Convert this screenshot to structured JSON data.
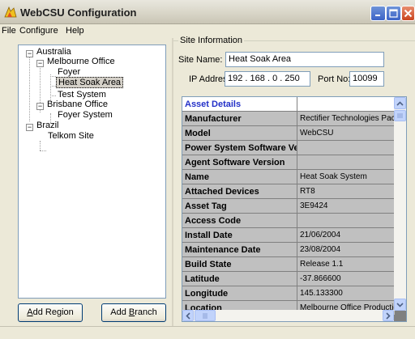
{
  "window": {
    "title": "WebCSU Configuration",
    "icon": "webcsu-app-icon"
  },
  "menu": [
    "File",
    "Configure",
    "Help"
  ],
  "tree": {
    "australia": "Australia",
    "melbourne": "Melbourne Office",
    "foyer": "Foyer",
    "heat_soak": "Heat Soak Area",
    "test_system": "Test System",
    "brisbane": "Brisbane Office",
    "foyer_system": "Foyer System",
    "brazil": "Brazil",
    "telkom": "Telkom Site",
    "selected": "Heat Soak Area"
  },
  "buttons": {
    "add_region_prefix": "A",
    "add_region_rest": "dd Region",
    "add_branch_prefix": "Add ",
    "add_branch_u": "B",
    "add_branch_rest": "ranch"
  },
  "site_info": {
    "group_label": "Site Information",
    "site_name_label": "Site Name:",
    "site_name_value": "Heat Soak Area",
    "ip_label": "IP Address:",
    "ip_octets": [
      "192",
      "168",
      "0",
      "250"
    ],
    "port_label": "Port No:",
    "port_value": "10099"
  },
  "asset_grid": {
    "header": "Asset Details",
    "rows": [
      {
        "key": "Manufacturer",
        "value": "Rectifier Technologies Pacific"
      },
      {
        "key": "Model",
        "value": "WebCSU"
      },
      {
        "key": "Power System Software Version",
        "value": ""
      },
      {
        "key": "Agent Software Version",
        "value": ""
      },
      {
        "key": "Name",
        "value": "Heat Soak System"
      },
      {
        "key": "Attached Devices",
        "value": "RT8"
      },
      {
        "key": "Asset Tag",
        "value": "3E9424"
      },
      {
        "key": "Access Code",
        "value": ""
      },
      {
        "key": "Install Date",
        "value": "21/06/2004"
      },
      {
        "key": "Maintenance Date",
        "value": "23/08/2004"
      },
      {
        "key": "Build State",
        "value": "Release 1.1"
      },
      {
        "key": "Latitude",
        "value": "-37.866600"
      },
      {
        "key": "Longitude",
        "value": "145.133300"
      },
      {
        "key": "Location",
        "value": "Melbourne Office Production"
      }
    ]
  },
  "colors": {
    "asset_header_text": "#2330c8",
    "titlebar_close": "#c9441e",
    "titlebar_button": "#3b63c6"
  }
}
